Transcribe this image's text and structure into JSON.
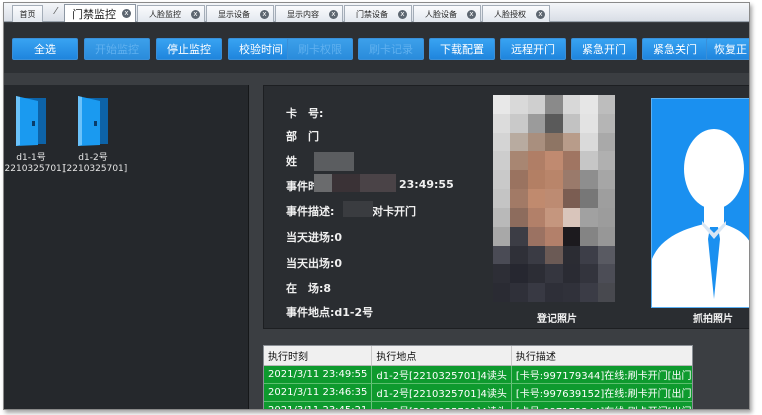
{
  "tabs": {
    "home": "首页",
    "items": [
      {
        "label": "门禁监控"
      },
      {
        "label": "人脸监控"
      },
      {
        "label": "显示设备"
      },
      {
        "label": "显示内容"
      },
      {
        "label": "门禁设备"
      },
      {
        "label": "人脸设备"
      },
      {
        "label": "人脸授权"
      }
    ],
    "close_glyph": "x"
  },
  "toolbar": {
    "buttons": [
      {
        "label": "全选",
        "enabled": true
      },
      {
        "label": "开始监控",
        "enabled": false
      },
      {
        "label": "停止监控",
        "enabled": true
      },
      {
        "label": "校验时间",
        "enabled": true
      },
      {
        "label": "刷卡权限",
        "enabled": false
      },
      {
        "label": "刷卡记录",
        "enabled": false
      },
      {
        "label": "下载配置",
        "enabled": true
      },
      {
        "label": "远程开门",
        "enabled": true
      },
      {
        "label": "紧急开门",
        "enabled": true
      },
      {
        "label": "紧急关门",
        "enabled": true
      },
      {
        "label": "恢复正",
        "enabled": true
      }
    ]
  },
  "devices": [
    {
      "name": "d1-1号",
      "serial": "[2210325701]"
    },
    {
      "name": "d1-2号",
      "serial": "[2210325701]"
    }
  ],
  "info": {
    "card_label": "卡　号:",
    "dept_label": "部　门",
    "name_label": "姓",
    "event_time_label": "事件时",
    "event_time_value": "23:49:55",
    "event_desc_label": "事件描述:",
    "event_desc_value": "对卡开门",
    "in_today_label": "当天进场:",
    "in_today_value": "0",
    "out_today_label": "当天出场:",
    "out_today_value": "0",
    "present_label": "在　场:",
    "present_value": "8",
    "location_label": "事件地点:",
    "location_value": "d1-2号"
  },
  "photos": {
    "registered_caption": "登记照片",
    "captured_caption": "抓拍照片"
  },
  "log": {
    "headers": [
      "执行时刻",
      "执行地点",
      "执行描述"
    ],
    "rows": [
      [
        "2021/3/11 23:49:55",
        "d1-2号[2210325701]4读头",
        "[卡号:997179344]在线:刷卡开门[出门]"
      ],
      [
        "2021/3/11 23:46:35",
        "d1-2号[2210325701]4读头",
        "[卡号:997639152]在线:刷卡开门[出门]"
      ],
      [
        "2021/3/11 23:45:21",
        "d1-2号[2210325701]4读头",
        "[卡号:997179344]在线:刷卡开门[出门]"
      ]
    ]
  },
  "colors": {
    "button_blue": "#2b93e6",
    "door_blue": "#1a9af0",
    "log_green": "#0e9a2e",
    "avatar_bg": "#1a90f0"
  }
}
